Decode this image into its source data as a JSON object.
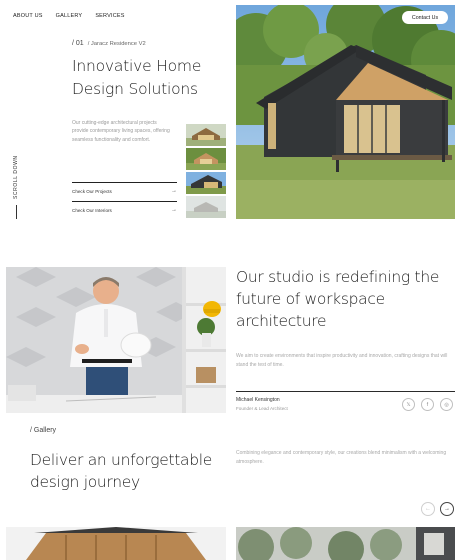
{
  "nav": {
    "items": [
      "ABOUT US",
      "GALLERY",
      "SERVICES"
    ],
    "contact_label": "Contact Us"
  },
  "hero": {
    "number": "/ 01",
    "project": "/ Jaracz Residence V2",
    "title_line1": "Innovative Home",
    "title_line2": "Design Solutions",
    "description": "Our cutting-edge architectural projects provide contemporary living spaces, offering seamless functionality and comfort.",
    "links": [
      {
        "label": "Check Our Projects",
        "arrow": "→"
      },
      {
        "label": "Check Our Interiors",
        "arrow": "→"
      }
    ],
    "scroll_label": "SCROLL DOWN"
  },
  "studio": {
    "title": "Our studio is redefining the future of workspace architecture",
    "description": "We aim to create environments that inspire productivity and innovation, crafting designs that will stand the test of time.",
    "author_name": "Michael Kensington",
    "author_role": "Founder & Lead Architect",
    "socials": [
      "x-icon",
      "facebook-icon",
      "instagram-icon"
    ]
  },
  "gallery": {
    "label": "/ Gallery",
    "title": "Deliver an unforgettable design journey",
    "description": "Combining elegance and contemporary style, our creations blend minimalism with a welcoming atmosphere.",
    "prev": "←",
    "next": "→"
  },
  "colors": {
    "text_dark": "#1e1e1e",
    "text_muted": "#a8a8a8",
    "house_dark": "#3a3a3a",
    "wood": "#c99a5b",
    "grass": "#7f9a4a",
    "sky": "#7fb1e0"
  }
}
